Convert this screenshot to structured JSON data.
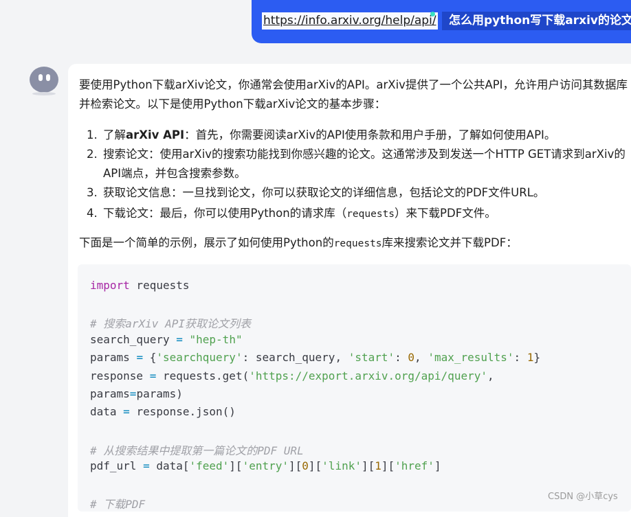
{
  "user_message": {
    "link": "https://info.arxiv.org/help/api/",
    "query": "怎么用python写下载arxiv的论文"
  },
  "answer": {
    "intro": "要使用Python下载arXiv论文，你通常会使用arXiv的API。arXiv提供了一个公共API，允许用户访问其数据库并检索论文。以下是使用Python下载arXiv论文的基本步骤：",
    "steps": [
      {
        "num": "1.",
        "prefix": "了解",
        "bold": "arXiv API",
        "text": "：首先，你需要阅读arXiv的API使用条款和用户手册，了解如何使用API。"
      },
      {
        "num": "2.",
        "text": "搜索论文：使用arXiv的搜索功能找到你感兴趣的论文。这通常涉及到发送一个HTTP GET请求到arXiv的API端点，并包含搜索参数。"
      },
      {
        "num": "3.",
        "text": "获取论文信息：一旦找到论文，你可以获取论文的详细信息，包括论文的PDF文件URL。"
      },
      {
        "num": "4.",
        "text_before": "下载论文：最后，你可以使用Python的请求库（",
        "code": "requests",
        "text_after": "）来下载PDF文件。"
      }
    ],
    "example_intro_before": "下面是一个简单的示例，展示了如何使用Python的",
    "example_intro_code": "requests",
    "example_intro_after": "库来搜索论文并下载PDF："
  },
  "code": {
    "l1_kw": "import",
    "l1_rest": " requests",
    "l2_cmt": "# 搜索arXiv API获取论文列表",
    "l3_a": "search_query ",
    "l3_op": "=",
    "l3_str": "\"hep-th\"",
    "l4_a": "params ",
    "l4_op": "=",
    "l4_b": " {",
    "l4_s1": "'searchquery'",
    "l4_c": ": search_query, ",
    "l4_s2": "'start'",
    "l4_d": ": ",
    "l4_n1": "0",
    "l4_e": ", ",
    "l4_s3": "'max_results'",
    "l4_f": ": ",
    "l4_n2": "1",
    "l4_g": "}",
    "l5_a": "response ",
    "l5_op": "=",
    "l5_b": " requests.get(",
    "l5_s": "'https://export.arxiv.org/api/query'",
    "l5_c": ",",
    "l6_a": "params",
    "l6_op": "=",
    "l6_b": "params)",
    "l7_a": "data ",
    "l7_op": "=",
    "l7_b": " response.json()",
    "l8_cmt": "# 从搜索结果中提取第一篇论文的PDF URL",
    "l9_a": "pdf_url ",
    "l9_op": "=",
    "l9_b": " data[",
    "l9_s1": "'feed'",
    "l9_c": "][",
    "l9_s2": "'entry'",
    "l9_d": "][",
    "l9_n1": "0",
    "l9_e": "][",
    "l9_s3": "'link'",
    "l9_f": "][",
    "l9_n2": "1",
    "l9_g": "][",
    "l9_s4": "'href'",
    "l9_h": "]",
    "l10_cmt": "# 下载PDF"
  },
  "watermark": "CSDN @小草cys",
  "colors": {
    "user_bubble": "#2c5cf2",
    "keyword": "#a626a4",
    "string": "#50a14f",
    "number": "#986801",
    "comment": "#a0a1a7"
  }
}
